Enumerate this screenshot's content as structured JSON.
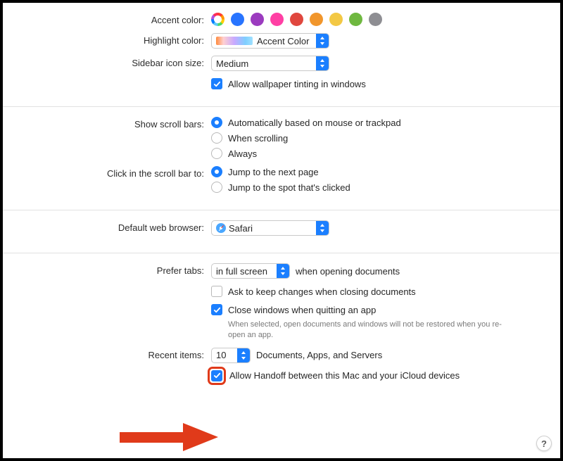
{
  "accent": {
    "label": "Accent color:",
    "colors": [
      "multicolor",
      "#2874ff",
      "#9b3bbf",
      "#ff3fa4",
      "#e0473e",
      "#f1962c",
      "#f3c844",
      "#6fb840",
      "#8e8e93"
    ]
  },
  "highlight": {
    "label": "Highlight color:",
    "value": "Accent Color"
  },
  "sidebar": {
    "label": "Sidebar icon size:",
    "value": "Medium"
  },
  "wallpaper_tint": {
    "checked": true,
    "label": "Allow wallpaper tinting in windows"
  },
  "scrollbars": {
    "label": "Show scroll bars:",
    "options": [
      {
        "label": "Automatically based on mouse or trackpad",
        "checked": true
      },
      {
        "label": "When scrolling",
        "checked": false
      },
      {
        "label": "Always",
        "checked": false
      }
    ]
  },
  "click_scrollbar": {
    "label": "Click in the scroll bar to:",
    "options": [
      {
        "label": "Jump to the next page",
        "checked": true
      },
      {
        "label": "Jump to the spot that's clicked",
        "checked": false
      }
    ]
  },
  "browser": {
    "label": "Default web browser:",
    "value": "Safari"
  },
  "tabs": {
    "label": "Prefer tabs:",
    "value": "in full screen",
    "suffix": "when opening documents"
  },
  "ask_close": {
    "checked": false,
    "label": "Ask to keep changes when closing documents"
  },
  "close_windows": {
    "checked": true,
    "label": "Close windows when quitting an app",
    "sub": "When selected, open documents and windows will not be restored when you re-open an app."
  },
  "recent": {
    "label": "Recent items:",
    "value": "10",
    "suffix": "Documents, Apps, and Servers"
  },
  "handoff": {
    "checked": true,
    "label": "Allow Handoff between this Mac and your iCloud devices"
  },
  "help": "?"
}
